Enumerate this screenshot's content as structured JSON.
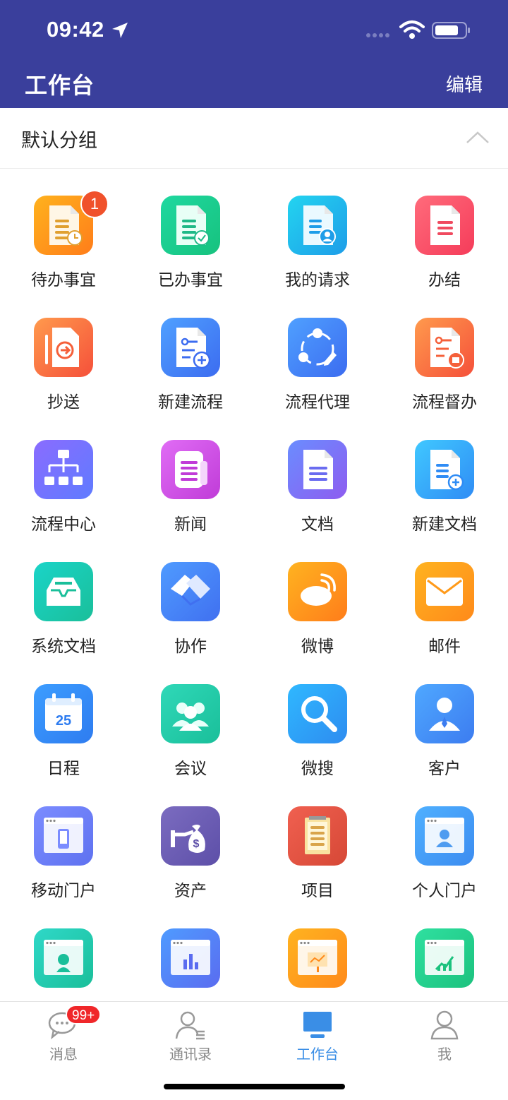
{
  "status_bar": {
    "time": "09:42"
  },
  "header": {
    "title": "工作台",
    "edit_label": "编辑"
  },
  "group": {
    "title": "默认分组"
  },
  "apps": [
    {
      "label": "待办事宜",
      "icon": "pending-tasks-icon",
      "badge": "1"
    },
    {
      "label": "已办事宜",
      "icon": "done-tasks-icon"
    },
    {
      "label": "我的请求",
      "icon": "my-requests-icon"
    },
    {
      "label": "办结",
      "icon": "completed-icon"
    },
    {
      "label": "抄送",
      "icon": "cc-icon"
    },
    {
      "label": "新建流程",
      "icon": "new-workflow-icon"
    },
    {
      "label": "流程代理",
      "icon": "workflow-proxy-icon"
    },
    {
      "label": "流程督办",
      "icon": "workflow-supervise-icon"
    },
    {
      "label": "流程中心",
      "icon": "workflow-center-icon"
    },
    {
      "label": "新闻",
      "icon": "news-icon"
    },
    {
      "label": "文档",
      "icon": "document-icon"
    },
    {
      "label": "新建文档",
      "icon": "new-document-icon"
    },
    {
      "label": "系统文档",
      "icon": "system-document-icon"
    },
    {
      "label": "协作",
      "icon": "collaboration-icon"
    },
    {
      "label": "微博",
      "icon": "weibo-icon"
    },
    {
      "label": "邮件",
      "icon": "mail-icon"
    },
    {
      "label": "日程",
      "icon": "calendar-icon",
      "text": "25"
    },
    {
      "label": "会议",
      "icon": "meeting-icon"
    },
    {
      "label": "微搜",
      "icon": "search-icon"
    },
    {
      "label": "客户",
      "icon": "customer-icon"
    },
    {
      "label": "移动门户",
      "icon": "mobile-portal-icon"
    },
    {
      "label": "资产",
      "icon": "assets-icon"
    },
    {
      "label": "项目",
      "icon": "project-icon"
    },
    {
      "label": "个人门户",
      "icon": "personal-portal-icon"
    },
    {
      "label": "",
      "icon": "service-portal-icon"
    },
    {
      "label": "",
      "icon": "report-portal-icon"
    },
    {
      "label": "",
      "icon": "presentation-portal-icon"
    },
    {
      "label": "",
      "icon": "analytics-portal-icon"
    }
  ],
  "tabs": [
    {
      "label": "消息",
      "icon": "message-icon",
      "badge": "99+"
    },
    {
      "label": "通讯录",
      "icon": "contacts-icon"
    },
    {
      "label": "工作台",
      "icon": "workbench-icon",
      "active": true
    },
    {
      "label": "我",
      "icon": "profile-icon"
    }
  ],
  "colors": {
    "header_bg": "#3a3f9c",
    "active_tab": "#3a8ee6",
    "badge": "#f0512b"
  }
}
